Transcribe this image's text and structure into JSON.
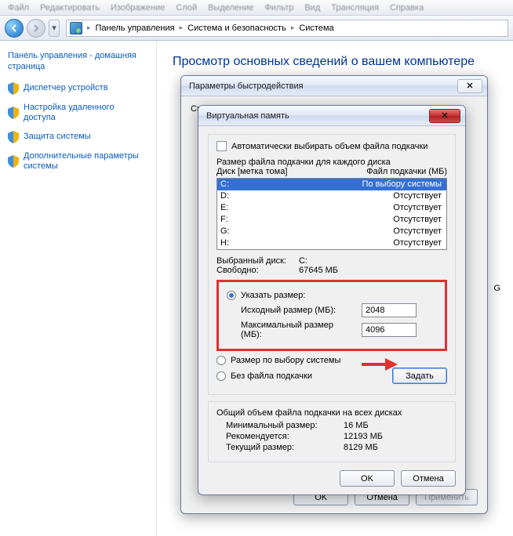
{
  "menubar": [
    "Файл",
    "Редактировать",
    "Изображение",
    "Слой",
    "Выделение",
    "Фильтр",
    "Вид",
    "Трансляция",
    "Справка"
  ],
  "breadcrumb": {
    "items": [
      "Панель управления",
      "Система и безопасность",
      "Система"
    ]
  },
  "sidebar": {
    "home": "Панель управления - домашняя страница",
    "items": [
      "Диспетчер устройств",
      "Настройка удаленного доступа",
      "Защита системы",
      "Дополнительные параметры системы"
    ]
  },
  "page_title": "Просмотр основных сведений о вашем компьютере",
  "perf_dialog": {
    "title": "Параметры быстродействия",
    "visible_prefix": "Св",
    "ok": "OK",
    "cancel": "Отмена",
    "apply": "Применить"
  },
  "vm_dialog": {
    "title": "Виртуальная память",
    "auto_label": "Автоматически выбирать объем файла подкачки",
    "auto_checked": false,
    "per_drive_label": "Размер файла подкачки для каждого диска",
    "col_drive": "Диск [метка тома]",
    "col_page": "Файл подкачки (МБ)",
    "drives": [
      {
        "letter": "C:",
        "status": "По выбору системы",
        "selected": true
      },
      {
        "letter": "D:",
        "status": "Отсутствует",
        "selected": false
      },
      {
        "letter": "E:",
        "status": "Отсутствует",
        "selected": false
      },
      {
        "letter": "F:",
        "status": "Отсутствует",
        "selected": false
      },
      {
        "letter": "G:",
        "status": "Отсутствует",
        "selected": false
      },
      {
        "letter": "H:",
        "status": "Отсутствует",
        "selected": false
      }
    ],
    "selected_drive_label": "Выбранный диск:",
    "selected_drive_value": "C:",
    "free_label": "Свободно:",
    "free_value": "67645 МБ",
    "custom_label": "Указать размер:",
    "initial_label": "Исходный размер (МБ):",
    "initial_value": "2048",
    "max_label": "Максимальный размер (МБ):",
    "max_value": "4096",
    "system_label": "Размер по выбору системы",
    "none_label": "Без файла подкачки",
    "set_btn": "Задать",
    "totals_header": "Общий объем файла подкачки на всех дисках",
    "min_label": "Минимальный размер:",
    "min_value": "16 МБ",
    "rec_label": "Рекомендуется:",
    "rec_value": "12193 МБ",
    "cur_label": "Текущий размер:",
    "cur_value": "8129 МБ",
    "ok": "OK",
    "cancel": "Отмена"
  },
  "background_letter": "G"
}
